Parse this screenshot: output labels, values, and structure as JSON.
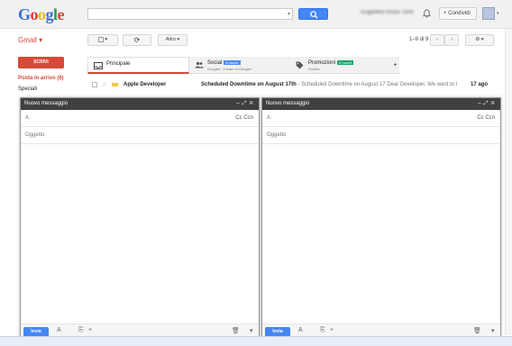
{
  "header": {
    "logo_letters": [
      "G",
      "o",
      "o",
      "g",
      "l",
      "e"
    ],
    "user_name_blurred": "Guglielmo Rossi Torre",
    "share_label": "+ Condividi"
  },
  "toolbar": {
    "app_label": "Gmail ▾",
    "more_label": "Altro ▾",
    "pager": "1–9 di 9"
  },
  "nav": {
    "compose_label": "SCRIVI",
    "inbox_label": "Posta in arrivo (6)",
    "starred_label": "Speciali"
  },
  "tabs": [
    {
      "label": "Principale",
      "sub": "",
      "badge": ""
    },
    {
      "label": "Social",
      "sub": "Google+, Il team di Google+",
      "badge": "8 nuove",
      "badge_color": "#4c8bf5"
    },
    {
      "label": "Promozioni",
      "sub": "Shutter",
      "badge": "6 nuove",
      "badge_color": "#16a765"
    }
  ],
  "mail": {
    "from": "Apple Developer",
    "subject": "Scheduled Downtime on August 17th",
    "snippet": " - Scheduled Downtime on August 17 Dear Developer, We want to l",
    "date": "17 ago"
  },
  "compose_left": {
    "title": "Nuovo messaggio",
    "to_label": "A",
    "cc_label": "Cc  Ccn",
    "subject_placeholder": "Oggetto",
    "send_label": "Invia"
  },
  "compose_right": {
    "title": "Nuovo messaggio",
    "to_label": "A",
    "cc_label": "Cc  Ccn",
    "subject_placeholder": "Oggetto",
    "send_label": "Invia"
  }
}
